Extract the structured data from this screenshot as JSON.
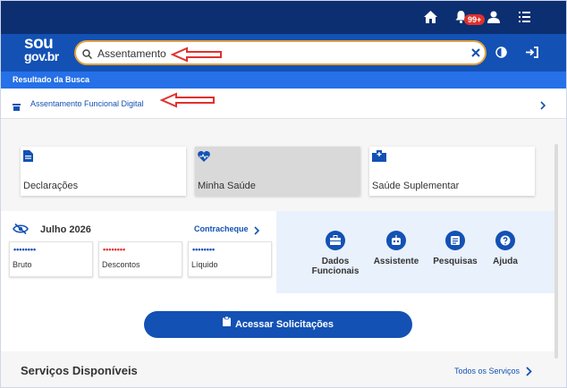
{
  "header": {
    "notification_badge": "99+",
    "logo_line1": "sou",
    "logo_line2": "gov.br"
  },
  "search": {
    "value": "Assentamento",
    "border_color": "#e3a13a"
  },
  "results": {
    "title": "Resultado da Busca",
    "items": [
      {
        "label": "Assentamento Funcional Digital"
      }
    ]
  },
  "cards": [
    {
      "label": "Declarações",
      "icon": "document-icon"
    },
    {
      "label": "Minha Saúde",
      "icon": "heart-pulse-icon"
    },
    {
      "label": "Saúde Suplementar",
      "icon": "hospital-icon"
    }
  ],
  "finance": {
    "month": "Julho 2026",
    "paycheck_link": "Contracheque",
    "items": [
      {
        "label": "Bruto",
        "masked": "••••••••",
        "color": "#1351b4"
      },
      {
        "label": "Descontos",
        "masked": "••••••••",
        "color": "#e0312b"
      },
      {
        "label": "Líquido",
        "masked": "••••••••",
        "color": "#1351b4"
      }
    ]
  },
  "shortcuts": [
    {
      "label_line1": "Dados",
      "label_line2": "Funcionais",
      "icon": "briefcase-icon"
    },
    {
      "label_line1": "Assistente",
      "label_line2": "",
      "icon": "robot-icon"
    },
    {
      "label_line1": "Pesquisas",
      "label_line2": "",
      "icon": "survey-icon"
    },
    {
      "label_line1": "Ajuda",
      "label_line2": "",
      "icon": "help-icon"
    }
  ],
  "actions": {
    "request_button": "Acessar Solicitações"
  },
  "services": {
    "title": "Serviços Disponíveis",
    "all_link": "Todos os Serviços"
  },
  "colors": {
    "top_bar": "#0c2f72",
    "header": "#1351b4",
    "results_band": "#2670e8",
    "accent": "#1351b4",
    "annotation_arrow": "#e0312b"
  }
}
